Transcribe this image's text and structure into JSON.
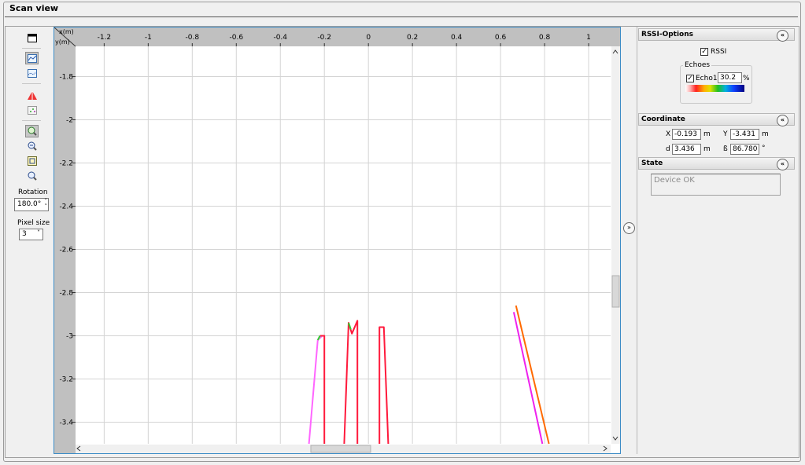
{
  "window": {
    "title": "Scan view"
  },
  "toolbar": {
    "rotation_label": "Rotation",
    "rotation_value": "180.0°",
    "pixel_size_label": "Pixel size",
    "pixel_size_value": "3"
  },
  "plot": {
    "x_axis_label": "x(m)",
    "y_axis_label": "y(m)",
    "x_ticks": [
      "-1.2",
      "-1",
      "-0.8",
      "-0.6",
      "-0.4",
      "-0.2",
      "0",
      "0.2",
      "0.4",
      "0.6",
      "0.8",
      "1"
    ],
    "y_ticks": [
      "-1.8",
      "-2",
      "-2.2",
      "-2.4",
      "-2.6",
      "-2.8",
      "-3",
      "-3.2",
      "-3.4"
    ]
  },
  "chart_data": {
    "type": "scatter",
    "xlabel": "x(m)",
    "ylabel": "y(m)",
    "xlim": [
      -1.33,
      1.1
    ],
    "ylim": [
      -3.5,
      -1.66
    ],
    "grid": true,
    "series": [
      {
        "color": "#ff66ff",
        "points": [
          [
            -0.27,
            -3.5
          ],
          [
            -0.23,
            -3.02
          ],
          [
            -0.21,
            -3.0
          ]
        ]
      },
      {
        "color": "#ff1a3c",
        "points": [
          [
            -0.2,
            -3.5
          ],
          [
            -0.2,
            -3.0
          ],
          [
            -0.22,
            -3.0
          ]
        ]
      },
      {
        "color": "#33cc33",
        "points": [
          [
            -0.23,
            -3.02
          ],
          [
            -0.22,
            -3.0
          ]
        ]
      },
      {
        "color": "#ff1a3c",
        "points": [
          [
            -0.11,
            -3.5
          ],
          [
            -0.09,
            -2.94
          ],
          [
            -0.075,
            -2.99
          ],
          [
            -0.05,
            -2.93
          ],
          [
            -0.05,
            -3.5
          ]
        ]
      },
      {
        "color": "#33cc33",
        "points": [
          [
            -0.09,
            -2.94
          ],
          [
            -0.08,
            -2.97
          ]
        ]
      },
      {
        "color": "#ff1a3c",
        "points": [
          [
            0.05,
            -3.5
          ],
          [
            0.05,
            -2.96
          ],
          [
            0.07,
            -2.96
          ],
          [
            0.09,
            -3.5
          ]
        ]
      },
      {
        "color": "#ee22ee",
        "points": [
          [
            0.66,
            -2.89
          ],
          [
            0.79,
            -3.5
          ]
        ]
      },
      {
        "color": "#ff6a00",
        "points": [
          [
            0.67,
            -2.86
          ],
          [
            0.82,
            -3.5
          ]
        ]
      }
    ]
  },
  "rssi": {
    "title": "RSSI-Options",
    "rssi_label": "RSSI",
    "rssi_checked": true,
    "echoes_label": "Echoes",
    "echo1_label": "Echo1",
    "echo1_checked": true,
    "echo1_value": "30.2",
    "echo1_unit": "%"
  },
  "coordinate": {
    "title": "Coordinate",
    "x_label": "X",
    "x_value": "-0.193",
    "x_unit": "m",
    "y_label": "Y",
    "y_value": "-3.431",
    "y_unit": "m",
    "d_label": "d",
    "d_value": "3.436",
    "d_unit": "m",
    "beta_label": "ß",
    "beta_value": "86.780",
    "beta_unit": "°"
  },
  "state": {
    "title": "State",
    "text": "Device OK"
  },
  "colors": {
    "accent_frame": "#3c8cc6",
    "grid": "#d4d4d4",
    "axis_bg": "#c0c0c0"
  }
}
